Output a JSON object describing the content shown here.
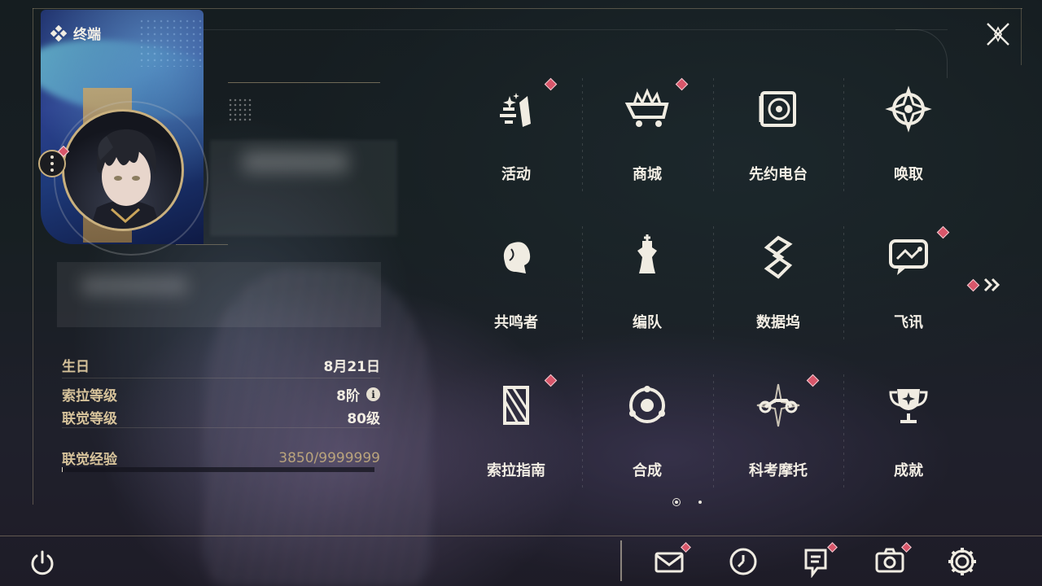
{
  "header": {
    "title": "终端"
  },
  "profile": {
    "stats": [
      {
        "label": "生日",
        "value": "8月21日"
      },
      {
        "label": "索拉等级",
        "value": "8阶"
      },
      {
        "label": "联觉等级",
        "value": "80级"
      }
    ],
    "exp": {
      "label": "联觉经验",
      "value": "3850/9999999",
      "current": 3850,
      "max": 9999999
    }
  },
  "menu": {
    "items": [
      {
        "label": "活动",
        "icon": "activity-icon",
        "badge": true
      },
      {
        "label": "商城",
        "icon": "shop-cart-icon",
        "badge": true
      },
      {
        "label": "先约电台",
        "icon": "radio-icon",
        "badge": false
      },
      {
        "label": "唤取",
        "icon": "convene-icon",
        "badge": false
      },
      {
        "label": "共鸣者",
        "icon": "resonator-icon",
        "badge": false
      },
      {
        "label": "编队",
        "icon": "team-chess-icon",
        "badge": false
      },
      {
        "label": "数据坞",
        "icon": "data-bank-icon",
        "badge": false
      },
      {
        "label": "飞讯",
        "icon": "message-bubble-icon",
        "badge": true
      },
      {
        "label": "索拉指南",
        "icon": "guide-icon",
        "badge": true
      },
      {
        "label": "合成",
        "icon": "synthesis-icon",
        "badge": false
      },
      {
        "label": "科考摩托",
        "icon": "motorcycle-icon",
        "badge": true
      },
      {
        "label": "成就",
        "icon": "trophy-icon",
        "badge": false
      }
    ],
    "page": {
      "current": 1,
      "total": 2
    }
  },
  "bottom_bar": {
    "buttons": [
      {
        "name": "mail-icon",
        "badge": true
      },
      {
        "name": "clock-icon",
        "badge": false
      },
      {
        "name": "notice-icon",
        "badge": true
      },
      {
        "name": "camera-icon",
        "badge": true
      },
      {
        "name": "settings-gear-icon",
        "badge": false
      }
    ]
  },
  "colors": {
    "accent_gold": "#c9b07e",
    "badge_red": "#d8566a",
    "text": "#f3eee4"
  }
}
